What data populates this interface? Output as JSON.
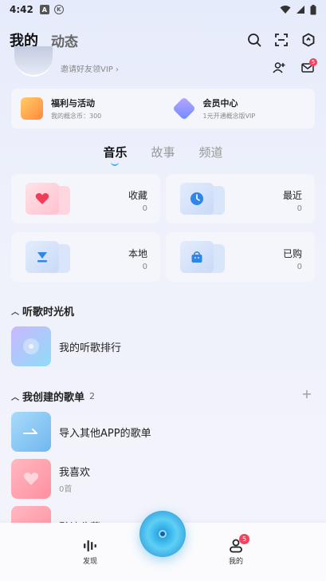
{
  "status": {
    "time": "4:42",
    "icon_a": "A",
    "icon_k": "K"
  },
  "header": {
    "tab_mine": "我的",
    "tab_dynamic": "动态"
  },
  "profile": {
    "invite_text": "邀请好友领VIP ›",
    "mail_badge": "5"
  },
  "promo": [
    {
      "title": "福利与活动",
      "sub": "我的概念币：300"
    },
    {
      "title": "会员中心",
      "sub": "1元开通概念版VIP"
    }
  ],
  "tabs": [
    "音乐",
    "故事",
    "频道"
  ],
  "cards": [
    {
      "title": "收藏",
      "count": "0"
    },
    {
      "title": "最近",
      "count": "0"
    },
    {
      "title": "本地",
      "count": "0"
    },
    {
      "title": "已购",
      "count": "0"
    }
  ],
  "time_machine": {
    "title": "听歌时光机",
    "item": "我的听歌排行"
  },
  "playlists": {
    "title": "我创建的歌单",
    "count": "2",
    "items": [
      {
        "title": "导入其他APP的歌单",
        "sub": ""
      },
      {
        "title": "我喜欢",
        "sub": "0首"
      },
      {
        "title": "默认收藏",
        "sub": ""
      }
    ]
  },
  "nav": {
    "discover": "发现",
    "mine": "我的",
    "mine_badge": "5"
  },
  "colors": {
    "accent": "#3fb0ea",
    "badge": "#f4425f"
  }
}
